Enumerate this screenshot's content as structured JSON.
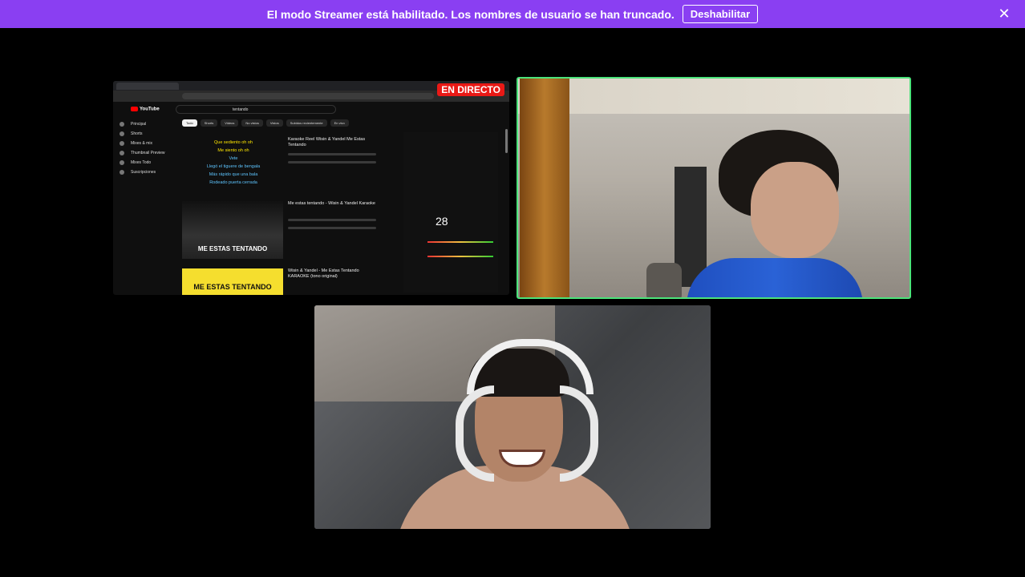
{
  "banner": {
    "message": "El modo Streamer está habilitado. Los nombres de usuario se han truncado.",
    "button_label": "Deshabilitar",
    "close_icon": "close-icon",
    "color": "#8a3ff2"
  },
  "screen_share": {
    "live_badge": "EN DIRECTO",
    "search_text": "tentando",
    "logo_text": "YouTube",
    "chips": [
      "Todo",
      "Shorts",
      "Videos",
      "No vistos",
      "Vistos",
      "Subidos recientemente",
      "En vivo"
    ],
    "sidebar": [
      "Principal",
      "Shorts",
      "Mixes & mix",
      "Thumbnail Preview",
      "Mixes Todo",
      "Suscripciones"
    ],
    "lyrics": [
      "Que sediento oh oh",
      "Me siento oh oh",
      "Vete",
      "Llegó el tiguere de bengala",
      "Más rápido que una bala",
      "Rodeado puerta cerrada"
    ],
    "thumb1_text": "ME ESTAS TENTANDO",
    "thumb2_text": "ME ESTAS TENTANDO",
    "video1_title": "Karaoke Reel Wisin & Yandel Me Estas Tentando",
    "video2_title": "Me estas tentando - Wisin & Yandel Karaoke",
    "video3_title": "Wisin & Yandel - Me Estas Tentando KARAOKE (tono original)",
    "panel_score": "28"
  },
  "accent_colors": {
    "speaking_border": "#4be37a",
    "live_red": "#e91916"
  }
}
